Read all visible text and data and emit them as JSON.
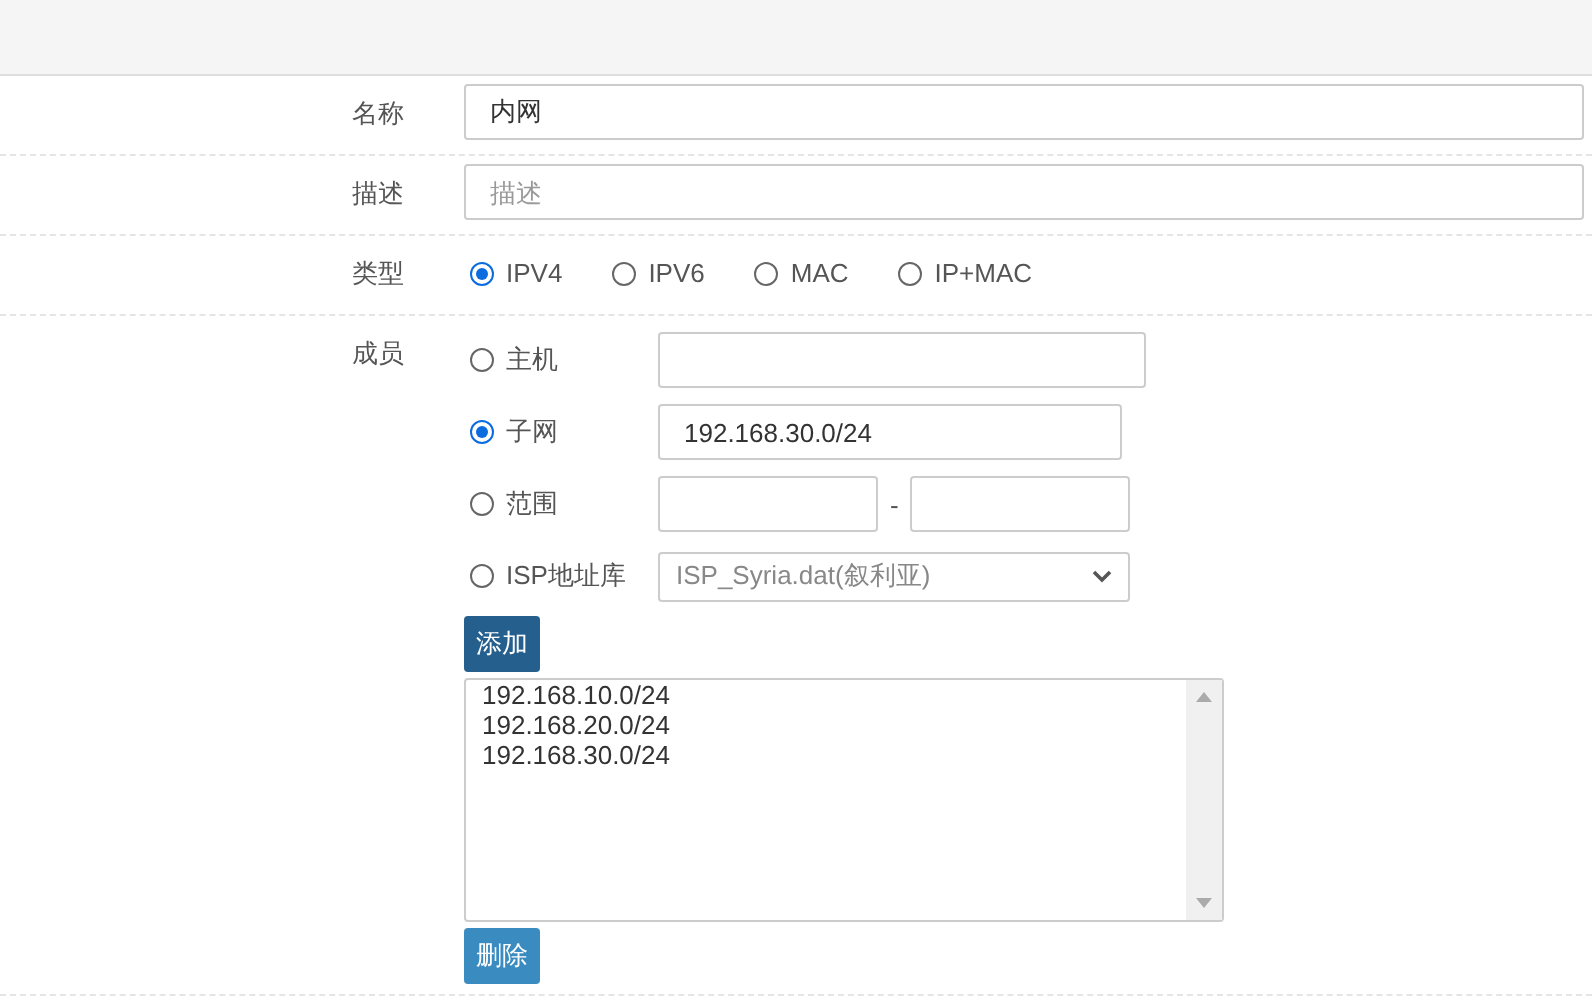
{
  "fields": [
    {
      "label": "名称",
      "value": "内网"
    },
    {
      "label": "描述",
      "placeholder": "描述"
    }
  ],
  "type": {
    "label": "类型",
    "options": [
      {
        "label": "IPV4",
        "selected": true
      },
      {
        "label": "IPV6",
        "selected": false
      },
      {
        "label": "MAC",
        "selected": false
      },
      {
        "label": "IP+MAC",
        "selected": false
      }
    ]
  },
  "members": {
    "label": "成员",
    "options": [
      {
        "kind": "text",
        "label": "主机",
        "selected": false
      },
      {
        "kind": "text",
        "label": "子网",
        "selected": true,
        "value": "192.168.30.0/24"
      },
      {
        "kind": "range",
        "label": "范围",
        "selected": false,
        "separator": "-"
      },
      {
        "kind": "select",
        "label": "ISP地址库",
        "selected": false,
        "value": "ISP_Syria.dat(叙利亚)"
      }
    ],
    "add_button": "添加",
    "list": [
      "192.168.10.0/24",
      "192.168.20.0/24",
      "192.168.30.0/24"
    ],
    "delete_button": "删除"
  }
}
